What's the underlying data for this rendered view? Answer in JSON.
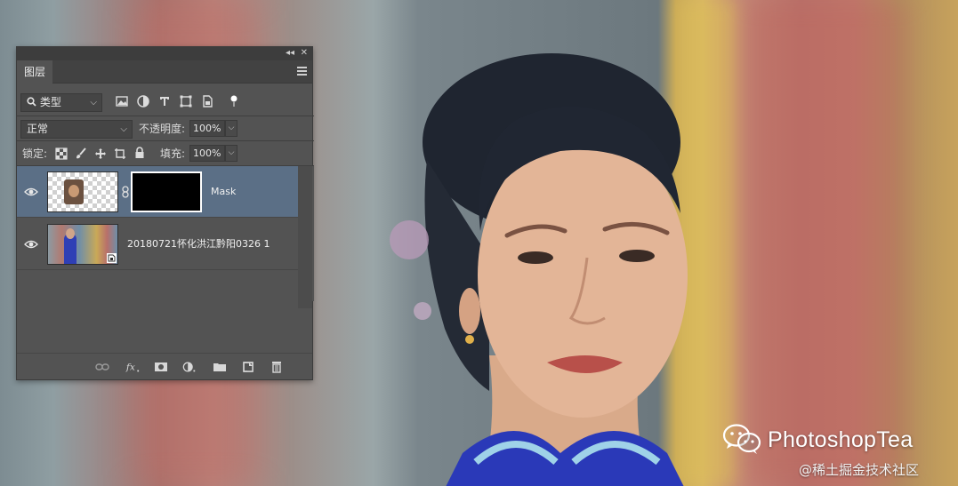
{
  "panel": {
    "tab_label": "图层",
    "filter": {
      "kind_label": "类型"
    },
    "blend_mode": "正常",
    "opacity_label": "不透明度:",
    "opacity_value": "100%",
    "lock_label": "锁定:",
    "fill_label": "填充:",
    "fill_value": "100%",
    "layers": [
      {
        "name": "Mask",
        "visible": true,
        "selected": true,
        "has_mask": true
      },
      {
        "name": "20180721怀化洪江黔阳0326 1",
        "visible": true,
        "selected": false,
        "smart_object": true
      }
    ]
  },
  "watermark": {
    "brand": "PhotoshopTea",
    "site": "@稀土掘金技术社区"
  },
  "colors": {
    "panel_bg": "#535353",
    "selected_layer": "#5b6f86",
    "panel_dark": "#3d3d3d"
  }
}
